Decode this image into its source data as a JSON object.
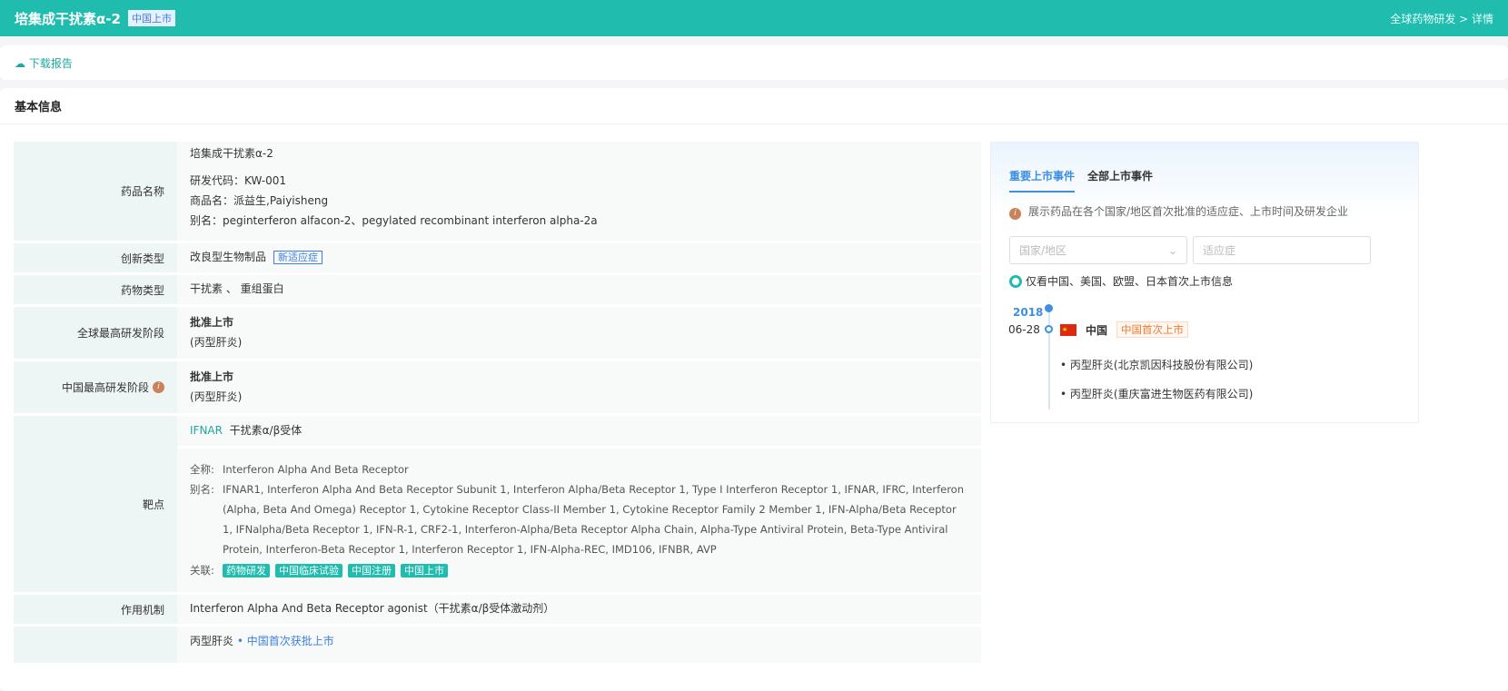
{
  "header": {
    "title": "培集成干扰素α-2",
    "status_badge": "中国上市",
    "breadcrumb": "全球药物研发 > 详情"
  },
  "toolbar": {
    "download": "下载报告"
  },
  "section_title": "基本信息",
  "rows": {
    "name": {
      "label": "药品名称",
      "primary": "培集成干扰素α-2",
      "code": "研发代码：KW-001",
      "trade": "商品名：派益生,Paiyisheng",
      "alias": "别名：peginterferon alfacon-2、pegylated recombinant interferon alpha-2a"
    },
    "innovation": {
      "label": "创新类型",
      "value": "改良型生物制品",
      "tag": "新适应症"
    },
    "drug_type": {
      "label": "药物类型",
      "value": "干扰素 、 重组蛋白"
    },
    "global_stage": {
      "label": "全球最高研发阶段",
      "value": "批准上市",
      "note": "(丙型肝炎)"
    },
    "china_stage": {
      "label": "中国最高研发阶段",
      "value": "批准上市",
      "note": "(丙型肝炎)"
    },
    "target": {
      "label": "靶点",
      "code": "IFNAR",
      "name": "干扰素α/β受体",
      "fullname_label": "全称:",
      "fullname": "Interferon Alpha And Beta Receptor",
      "alias_label": "别名:",
      "alias": "IFNAR1, Interferon Alpha And Beta Receptor Subunit 1, Interferon Alpha/Beta Receptor 1, Type I Interferon Receptor 1, IFNAR, IFRC, Interferon (Alpha, Beta And Omega) Receptor 1, Cytokine Receptor Class-II Member 1, Cytokine Receptor Family 2 Member 1, IFN-Alpha/Beta Receptor 1, IFNalpha/Beta Receptor 1, IFN-R-1, CRF2-1, Interferon-Alpha/Beta Receptor Alpha Chain, Alpha-Type Antiviral Protein, Beta-Type Antiviral Protein, Interferon-Beta Receptor 1, Interferon Receptor 1, IFN-Alpha-REC, IMD106, IFNBR, AVP",
      "related_label": "关联:",
      "related": [
        "药物研发",
        "中国临床试验",
        "中国注册",
        "中国上市"
      ]
    },
    "mechanism": {
      "label": "作用机制",
      "value": "Interferon Alpha And Beta Receptor agonist（干扰素α/β受体激动剂）"
    },
    "indication": {
      "value": "丙型肝炎",
      "link": "• 中国首次获批上市"
    }
  },
  "panel": {
    "tabs": [
      "重要上市事件",
      "全部上市事件"
    ],
    "info": "展示药品在各个国家/地区首次批准的适应症、上市时间及研发企业",
    "country_placeholder": "国家/地区",
    "indication_placeholder": "适应症",
    "toggle": "仅看中国、美国、欧盟、日本首次上市信息",
    "year": "2018",
    "date": "06-28",
    "country": "中国",
    "event_tag": "中国首次上市",
    "items": [
      "丙型肝炎(北京凯因科技股份有限公司)",
      "丙型肝炎(重庆富进生物医药有限公司)"
    ]
  }
}
